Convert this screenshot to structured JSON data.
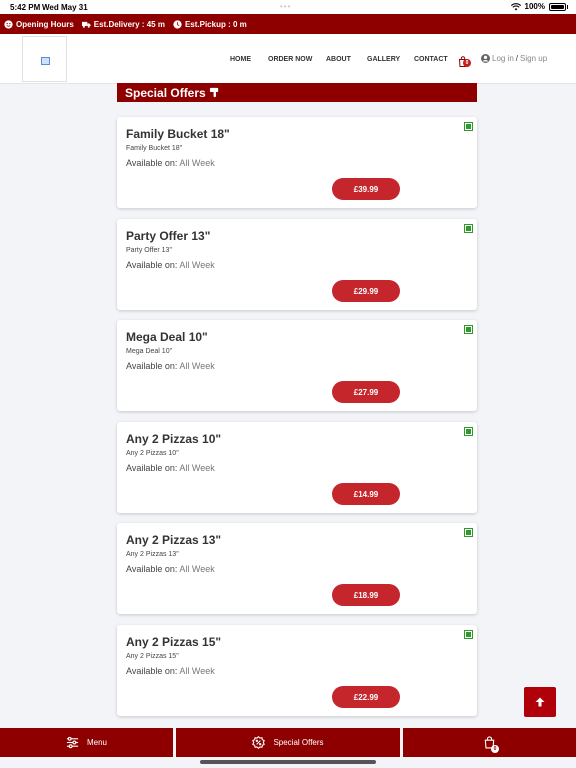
{
  "status_bar": {
    "time": "5:42 PM",
    "date": "Wed May 31",
    "dots": "•••",
    "battery": "100%"
  },
  "info_bar": {
    "opening_hours": "Opening Hours",
    "delivery": "Est.Delivery : 45 m",
    "pickup": "Est.Pickup : 0 m"
  },
  "nav": {
    "home": "HOME",
    "order_now": "ORDER NOW",
    "about": "ABOUT",
    "gallery": "GALLERY",
    "contact": "CONTACT",
    "cart_count": "0",
    "login": "Log in",
    "separator": "/",
    "signup": "Sign up"
  },
  "section_title": "Special Offers",
  "offers": [
    {
      "name": "Family Bucket 18\"",
      "subtitle": "Family Bucket 18\"",
      "avail_label": "Available on:",
      "avail_value": "All Week",
      "price": "£39.99"
    },
    {
      "name": "Party Offer 13\"",
      "subtitle": "Party Offer 13\"",
      "avail_label": "Available on:",
      "avail_value": "All Week",
      "price": "£29.99"
    },
    {
      "name": "Mega Deal 10\"",
      "subtitle": "Mega Deal 10\"",
      "avail_label": "Available on:",
      "avail_value": "All Week",
      "price": "£27.99"
    },
    {
      "name": "Any 2 Pizzas 10\"",
      "subtitle": "Any 2 Pizzas 10\"",
      "avail_label": "Available on:",
      "avail_value": "All Week",
      "price": "£14.99"
    },
    {
      "name": "Any 2 Pizzas 13\"",
      "subtitle": "Any 2 Pizzas 13\"",
      "avail_label": "Available on:",
      "avail_value": "All Week",
      "price": "£18.99"
    },
    {
      "name": "Any 2 Pizzas 15\"",
      "subtitle": "Any 2 Pizzas 15\"",
      "avail_label": "Available on:",
      "avail_value": "All Week",
      "price": "£22.99"
    }
  ],
  "bottom_bar": {
    "menu": "Menu",
    "special_offers": "Special Offers",
    "cart_count": "0"
  },
  "colors": {
    "brand": "#8e0000",
    "price_button": "#c4262c",
    "veg": "#2e9a2e",
    "background": "#f3f4f8"
  },
  "icons": [
    "smiley-icon",
    "truck-icon",
    "clock-icon",
    "cart-icon",
    "user-icon",
    "hand-pointer-icon",
    "veg-icon",
    "arrow-up-icon",
    "sliders-icon",
    "offer-badge-icon",
    "shopping-bag-icon",
    "wifi-icon",
    "battery-icon"
  ]
}
